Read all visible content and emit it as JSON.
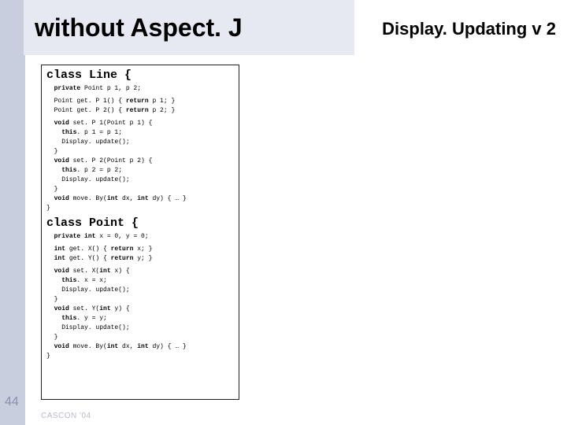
{
  "title": "without Aspect. J",
  "subtitle": "Display. Updating v 2",
  "page_number": "44",
  "footer": "CASCON '04",
  "class_line_header": "class Line {",
  "class_point_header": "class Point {",
  "line_priv": "  <b>private</b> Point p 1, p 2;",
  "line_getters": "  Point get. P 1() { <b>return</b> p 1; }\n  Point get. P 2() { <b>return</b> p 2; }",
  "line_body": "  <b>void</b> set. P 1(Point p 1) {\n    <b>this</b>. p 1 = p 1;\n    Display. update();\n  }\n  <b>void</b> set. P 2(Point p 2) {\n    <b>this</b>. p 2 = p 2;\n    Display. update();\n  }\n  <b>void</b> move. By(<b>int</b> dx, <b>int</b> dy) { … }\n}",
  "point_priv": "  <b>private int</b> x = 0, y = 0;",
  "point_getters": "  <b>int</b> get. X() { <b>return</b> x; }\n  <b>int</b> get. Y() { <b>return</b> y; }",
  "point_body": "  <b>void</b> set. X(<b>int</b> x) {\n    <b>this</b>. x = x;\n    Display. update();\n  }\n  <b>void</b> set. Y(<b>int</b> y) {\n    <b>this</b>. y = y;\n    Display. update();\n  }\n  <b>void</b> move. By(<b>int</b> dx, <b>int</b> dy) { … }\n}"
}
